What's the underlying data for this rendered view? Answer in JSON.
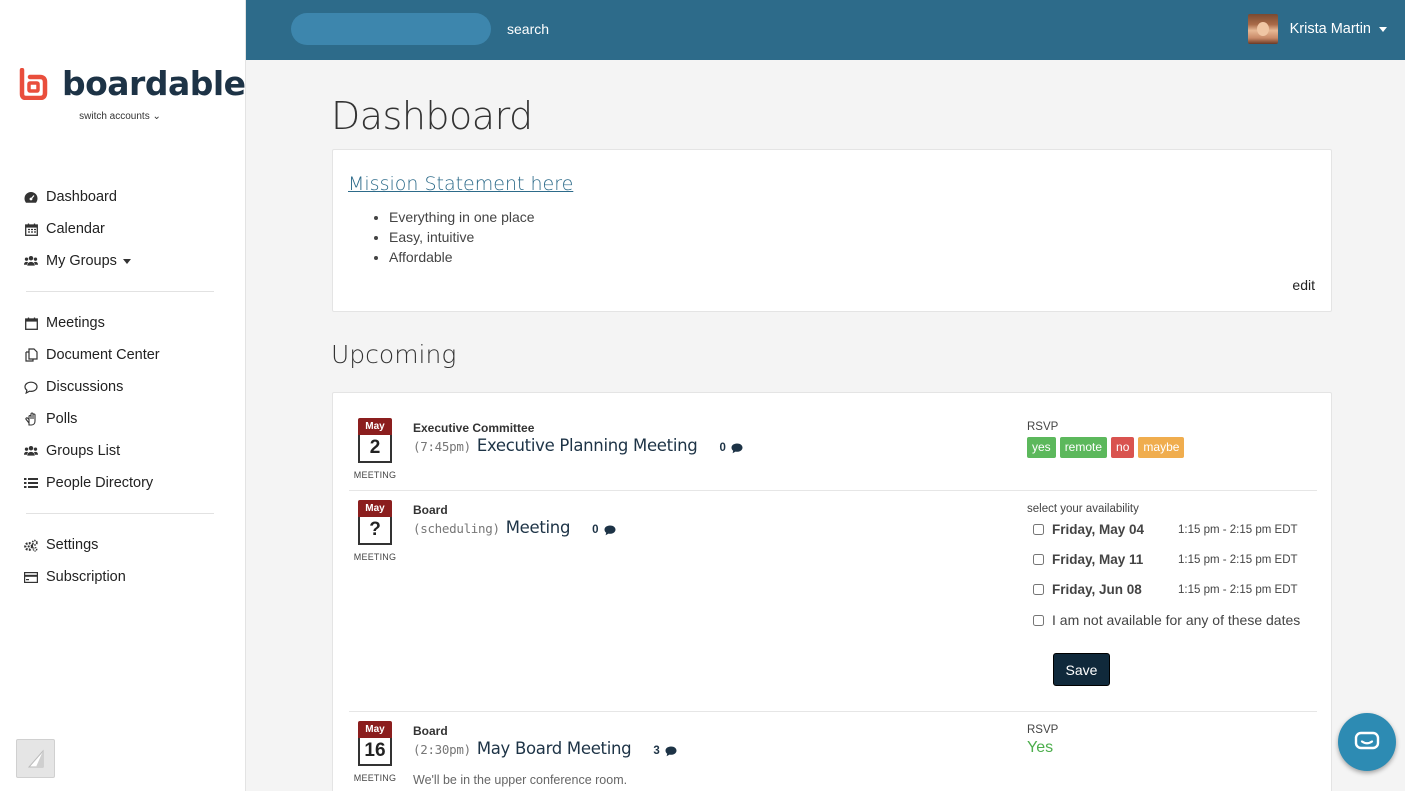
{
  "brand": {
    "name": "boardable",
    "switch_accounts": "switch accounts ⌄",
    "logo_color": "#e94e3c"
  },
  "sidebar": {
    "group1": [
      {
        "label": "Dashboard",
        "icon": "dashboard-icon"
      },
      {
        "label": "Calendar",
        "icon": "calendar-icon"
      },
      {
        "label": "My Groups",
        "icon": "users-icon"
      }
    ],
    "group2": [
      {
        "label": "Meetings",
        "icon": "calendar-blank-icon"
      },
      {
        "label": "Document Center",
        "icon": "documents-icon"
      },
      {
        "label": "Discussions",
        "icon": "comment-icon"
      },
      {
        "label": "Polls",
        "icon": "hand-icon"
      },
      {
        "label": "Groups List",
        "icon": "users-icon"
      },
      {
        "label": "People Directory",
        "icon": "list-icon"
      }
    ],
    "group3": [
      {
        "label": "Settings",
        "icon": "gears-icon"
      },
      {
        "label": "Subscription",
        "icon": "credit-card-icon"
      }
    ]
  },
  "topbar": {
    "search_placeholder": "",
    "search_label": "search",
    "user_name": "Krista Martin",
    "color": "#2d6b8a"
  },
  "page": {
    "title": "Dashboard"
  },
  "mission": {
    "link": "Mission Statement here",
    "bullets": [
      "Everything in one place",
      "Easy, intuitive",
      "Affordable"
    ],
    "edit": "edit"
  },
  "upcoming": {
    "title": "Upcoming",
    "events": [
      {
        "month": "May",
        "day": "2",
        "type": "MEETING",
        "group": "Executive Committee",
        "time": "(7:45pm)",
        "title": "Executive Planning Meeting",
        "comments": "0",
        "rsvp_label": "RSVP",
        "rsvp_options": [
          {
            "label": "yes",
            "color": "#5cb85c"
          },
          {
            "label": "remote",
            "color": "#5cb85c"
          },
          {
            "label": "no",
            "color": "#d9534f"
          },
          {
            "label": "maybe",
            "color": "#f0ad4e"
          }
        ]
      },
      {
        "month": "May",
        "day": "?",
        "type": "MEETING",
        "group": "Board",
        "time": "(scheduling)",
        "title": "Meeting",
        "comments": "0",
        "availability_label": "select your availability",
        "slots": [
          {
            "date": "Friday, May 04",
            "time": "1:15 pm - 2:15 pm EDT"
          },
          {
            "date": "Friday, May 11",
            "time": "1:15 pm - 2:15 pm EDT"
          },
          {
            "date": "Friday, Jun 08",
            "time": "1:15 pm - 2:15 pm EDT"
          }
        ],
        "none_label": "I am not available for any of these dates",
        "save": "Save"
      },
      {
        "month": "May",
        "day": "16",
        "type": "MEETING",
        "group": "Board",
        "time": "(2:30pm)",
        "title": "May Board Meeting",
        "comments": "3",
        "note": "We'll be in the upper conference room.",
        "rsvp_label": "RSVP",
        "rsvp_value": "Yes"
      }
    ]
  }
}
